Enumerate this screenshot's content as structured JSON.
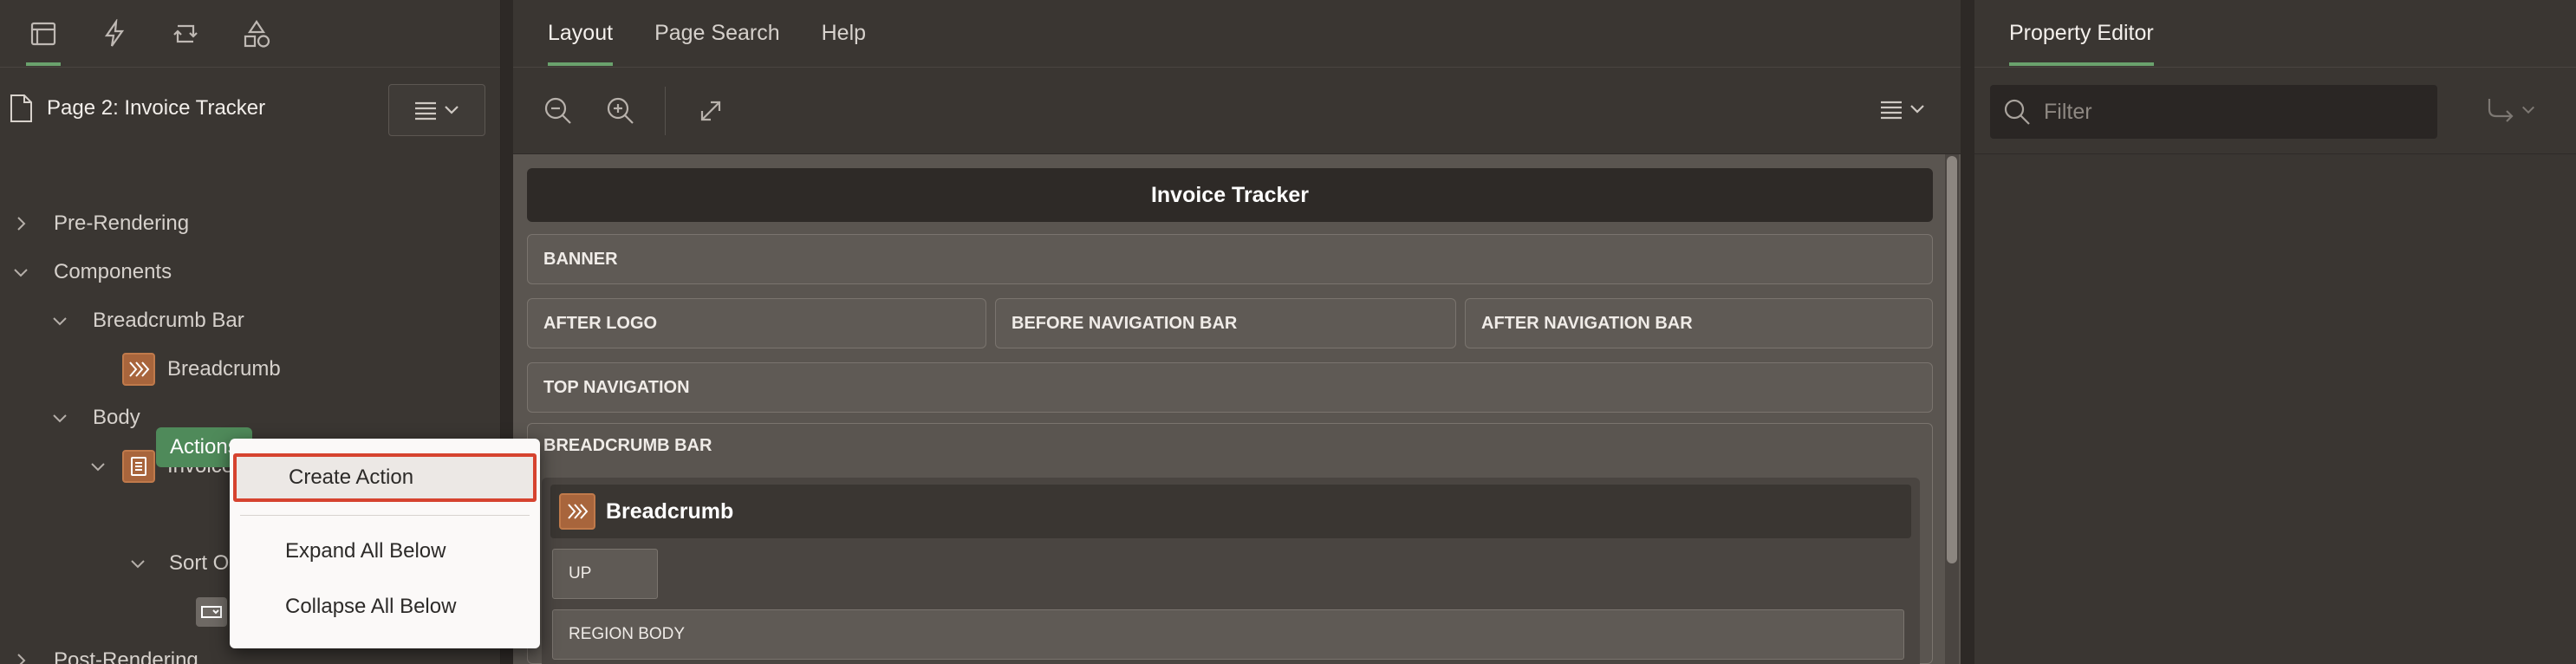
{
  "left": {
    "tabs": [
      "rendering",
      "dynamic-actions",
      "processing",
      "shared-components"
    ],
    "page_title": "Page 2: Invoice Tracker",
    "tree": {
      "pre_rendering": "Pre-Rendering",
      "components": "Components",
      "breadcrumb_bar": "Breadcrumb Bar",
      "breadcrumb": "Breadcrumb",
      "body": "Body",
      "invoice_tracker": "Invoice Tracker",
      "actions": "Actions",
      "sort_order": "Sort O",
      "post_rendering": "Post-Rendering"
    }
  },
  "context_menu": {
    "create_action": "Create Action",
    "expand_all": "Expand All Below",
    "collapse_all": "Collapse All Below"
  },
  "center": {
    "tabs": {
      "layout": "Layout",
      "page_search": "Page Search",
      "help": "Help"
    },
    "page_header": "Invoice Tracker",
    "regions": {
      "banner": "BANNER",
      "after_logo": "AFTER LOGO",
      "before_nav": "BEFORE NAVIGATION BAR",
      "after_nav": "AFTER NAVIGATION BAR",
      "top_nav": "TOP NAVIGATION",
      "breadcrumb_bar": "BREADCRUMB BAR",
      "breadcrumb": "Breadcrumb",
      "up": "UP",
      "region_body": "REGION BODY"
    }
  },
  "right": {
    "title": "Property Editor",
    "filter_placeholder": "Filter"
  },
  "colors": {
    "accent_green": "#6aa26d",
    "highlight_red": "#d6432f",
    "orange_icon": "#a8653c"
  }
}
